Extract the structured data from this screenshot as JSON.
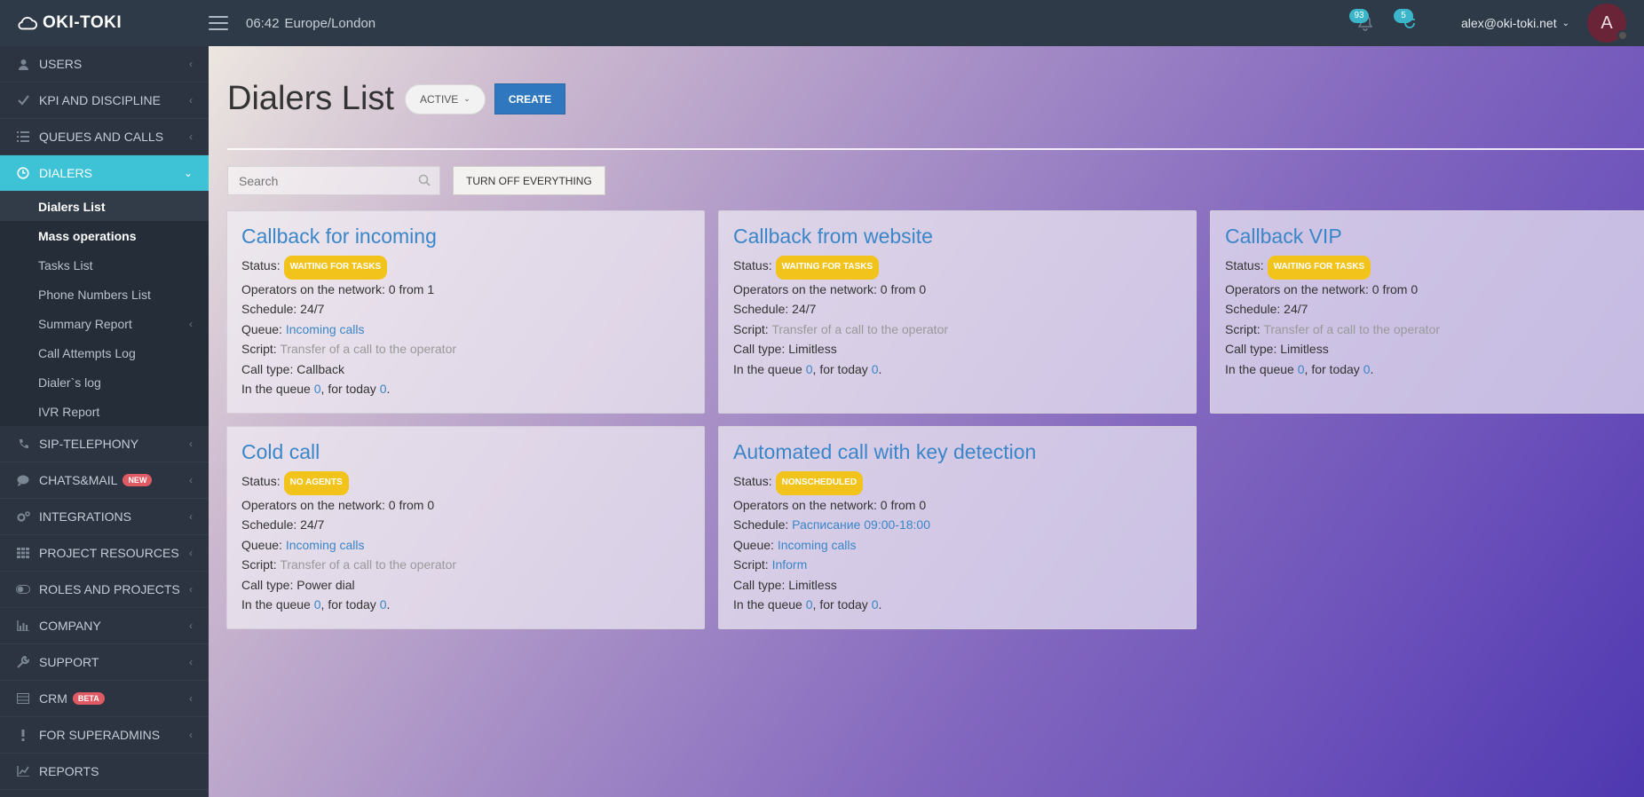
{
  "header": {
    "brand": "OKI-TOKI",
    "time": "06:42",
    "timezone": "Europe/London",
    "notifications_count": "93",
    "tasks_count": "5",
    "user_email": "alex@oki-toki.net",
    "avatar_letter": "A"
  },
  "sidebar": {
    "items": [
      {
        "label": "USERS",
        "icon": "user-icon"
      },
      {
        "label": "KPI AND DISCIPLINE",
        "icon": "check-icon"
      },
      {
        "label": "QUEUES AND CALLS",
        "icon": "list-icon"
      },
      {
        "label": "DIALERS",
        "icon": "clock-icon"
      },
      {
        "label": "SIP-TELEPHONY",
        "icon": "phone-icon"
      },
      {
        "label": "CHATS&MAIL",
        "icon": "chat-icon",
        "tag": "NEW"
      },
      {
        "label": "INTEGRATIONS",
        "icon": "gears-icon"
      },
      {
        "label": "PROJECT RESOURCES",
        "icon": "grid-icon"
      },
      {
        "label": "ROLES AND PROJECTS",
        "icon": "toggle-icon"
      },
      {
        "label": "COMPANY",
        "icon": "bar-chart-icon"
      },
      {
        "label": "SUPPORT",
        "icon": "wrench-icon"
      },
      {
        "label": "CRM",
        "icon": "table-icon",
        "tag": "BETA"
      },
      {
        "label": "FOR SUPERADMINS",
        "icon": "exclamation-icon"
      },
      {
        "label": "REPORTS",
        "icon": "line-chart-icon"
      }
    ],
    "dialers_sub": [
      {
        "label": "Dialers List"
      },
      {
        "label": "Mass operations"
      },
      {
        "label": "Tasks List"
      },
      {
        "label": "Phone Numbers List"
      },
      {
        "label": "Summary Report"
      },
      {
        "label": "Call Attempts Log"
      },
      {
        "label": "Dialer`s log"
      },
      {
        "label": "IVR Report"
      }
    ]
  },
  "main": {
    "title": "Dialers List",
    "filter_label": "ACTIVE",
    "create_label": "CREATE",
    "search_placeholder": "Search",
    "turn_off_label": "TURN OFF EVERYTHING",
    "labels": {
      "status": "Status:",
      "operators": "Operators on the network:",
      "schedule": "Schedule:",
      "queue": "Queue:",
      "script": "Script:",
      "call_type": "Call type:",
      "in_queue": "In the queue",
      "for_today": ", for today",
      "end": "."
    },
    "cards": [
      {
        "title": "Callback for incoming",
        "status": "WAITING FOR TASKS",
        "operators": "0 from 1",
        "schedule": "24/7",
        "queue": "Incoming calls",
        "script": "Transfer of a call to the operator",
        "call_type": "Callback",
        "in_queue": "0",
        "today": "0"
      },
      {
        "title": "Callback from website",
        "status": "WAITING FOR TASKS",
        "operators": "0 from 0",
        "schedule": "24/7",
        "script": "Transfer of a call to the operator",
        "call_type": "Limitless",
        "in_queue": "0",
        "today": "0"
      },
      {
        "title": "Callback VIP",
        "status": "WAITING FOR TASKS",
        "operators": "0 from 0",
        "schedule": "24/7",
        "script": "Transfer of a call to the operator",
        "call_type": "Limitless",
        "in_queue": "0",
        "today": "0"
      },
      {
        "title": "Cold call",
        "status": "NO AGENTS",
        "operators": "0 from 0",
        "schedule": "24/7",
        "queue": "Incoming calls",
        "script": "Transfer of a call to the operator",
        "call_type": "Power dial",
        "in_queue": "0",
        "today": "0"
      },
      {
        "title": "Automated call with key detection",
        "status": "NONSCHEDULED",
        "operators": "0 from 0",
        "schedule": "Расписание 09:00-18:00",
        "queue": "Incoming calls",
        "script": "Inform",
        "call_type": "Limitless",
        "in_queue": "0",
        "today": "0"
      }
    ]
  },
  "colors": {
    "accent": "#3ec3d6",
    "link": "#3a86c8",
    "badge_yellow": "#f2c31b",
    "create_button": "#2f78c0",
    "sidebar_bg": "#2b3440"
  }
}
